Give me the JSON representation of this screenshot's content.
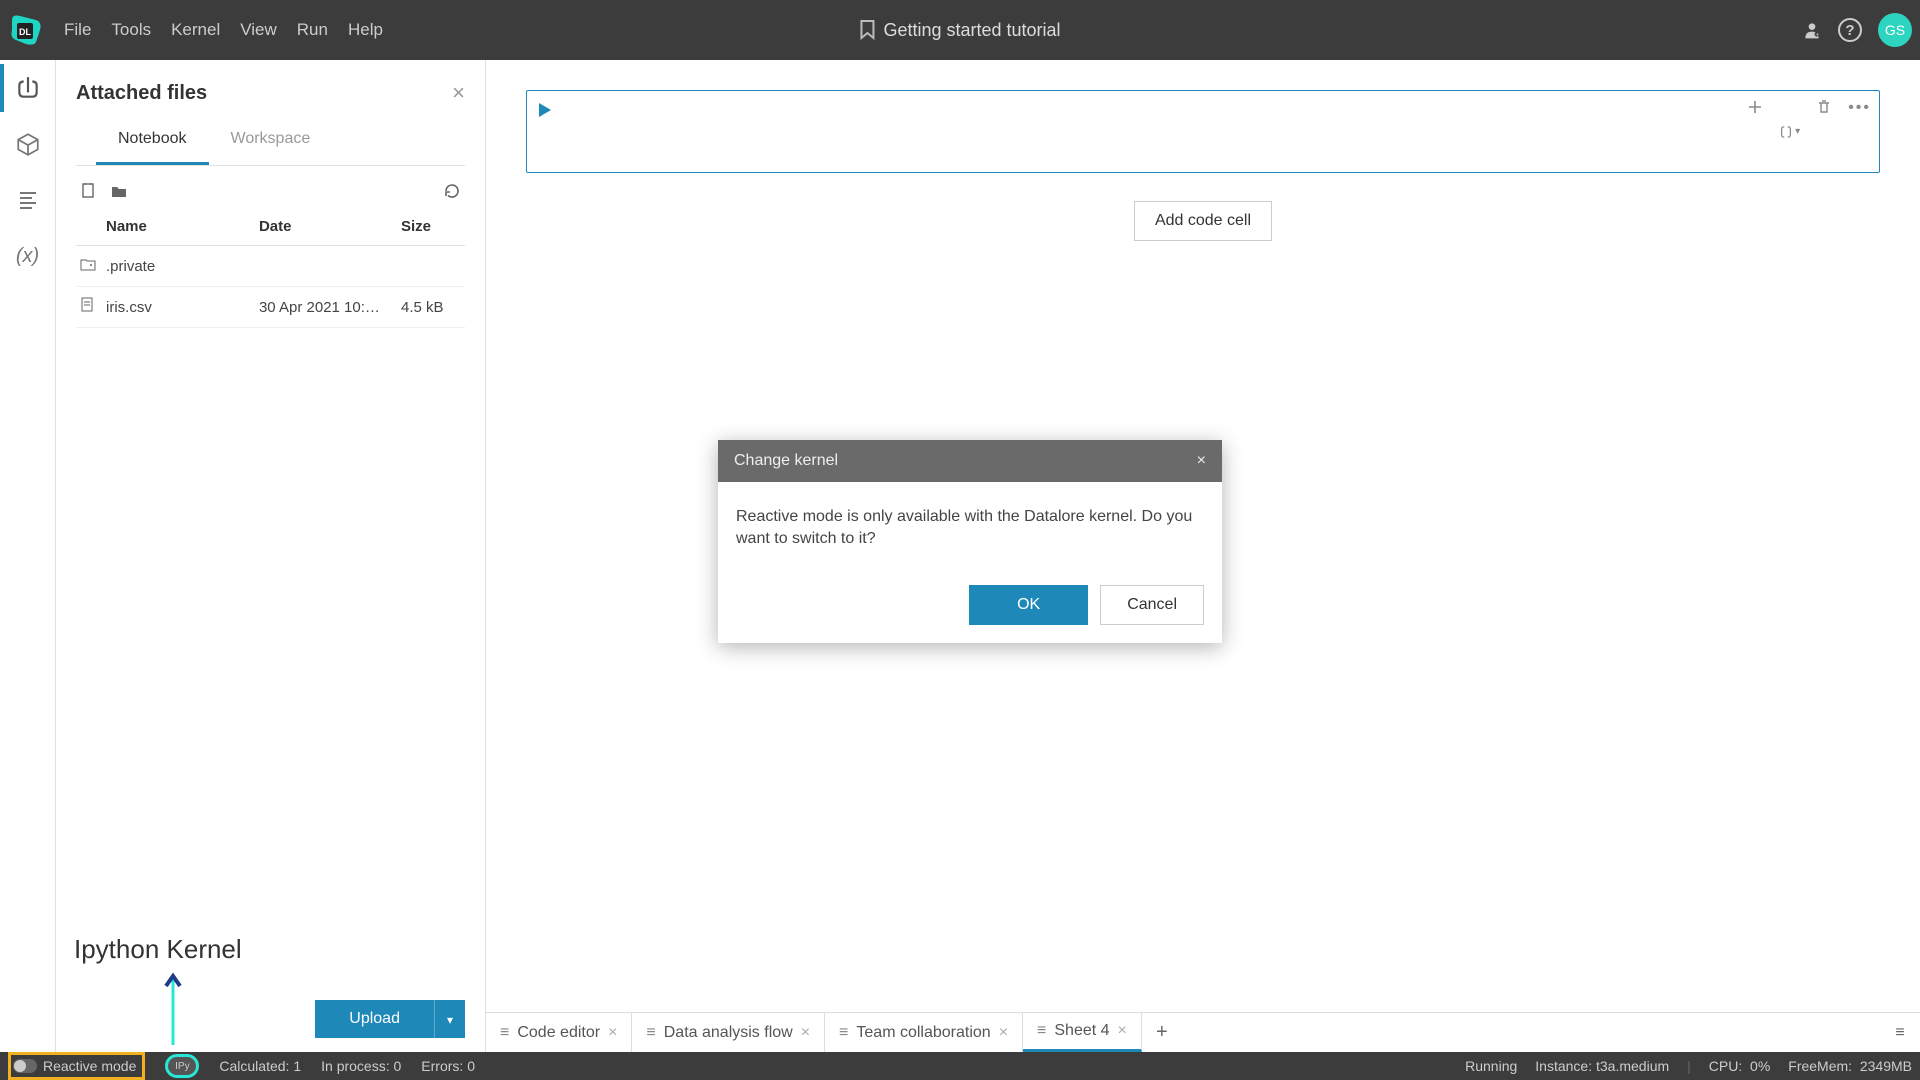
{
  "menu": {
    "file": "File",
    "tools": "Tools",
    "kernel": "Kernel",
    "view": "View",
    "run": "Run",
    "help": "Help"
  },
  "title": "Getting started tutorial",
  "avatar": "GS",
  "panel": {
    "title": "Attached files",
    "tabs": {
      "notebook": "Notebook",
      "workspace": "Workspace"
    },
    "cols": {
      "name": "Name",
      "date": "Date",
      "size": "Size"
    },
    "rows": [
      {
        "name": ".private",
        "date": "",
        "size": ""
      },
      {
        "name": "iris.csv",
        "date": "30 Apr 2021 10:…",
        "size": "4.5 kB"
      }
    ],
    "upload": "Upload"
  },
  "annotation": "Ipython Kernel",
  "editor": {
    "add_cell": "Add code cell"
  },
  "sheets": [
    {
      "label": "Code editor"
    },
    {
      "label": "Data analysis flow"
    },
    {
      "label": "Team collaboration"
    },
    {
      "label": "Sheet 4"
    }
  ],
  "modal": {
    "title": "Change kernel",
    "message": "Reactive mode is only available with the Datalore kernel. Do you want to switch to it?",
    "ok": "OK",
    "cancel": "Cancel"
  },
  "status": {
    "reactive": "Reactive mode",
    "ipy": "IPy",
    "calculated_l": "Calculated:",
    "calculated_v": "1",
    "inprocess_l": "In process:",
    "inprocess_v": "0",
    "errors_l": "Errors:",
    "errors_v": "0",
    "running": "Running",
    "instance_l": "Instance:",
    "instance_v": "t3a.medium",
    "cpu_l": "CPU:",
    "cpu_v": "0%",
    "mem_l": "FreeMem:",
    "mem_v": "2349MB"
  }
}
